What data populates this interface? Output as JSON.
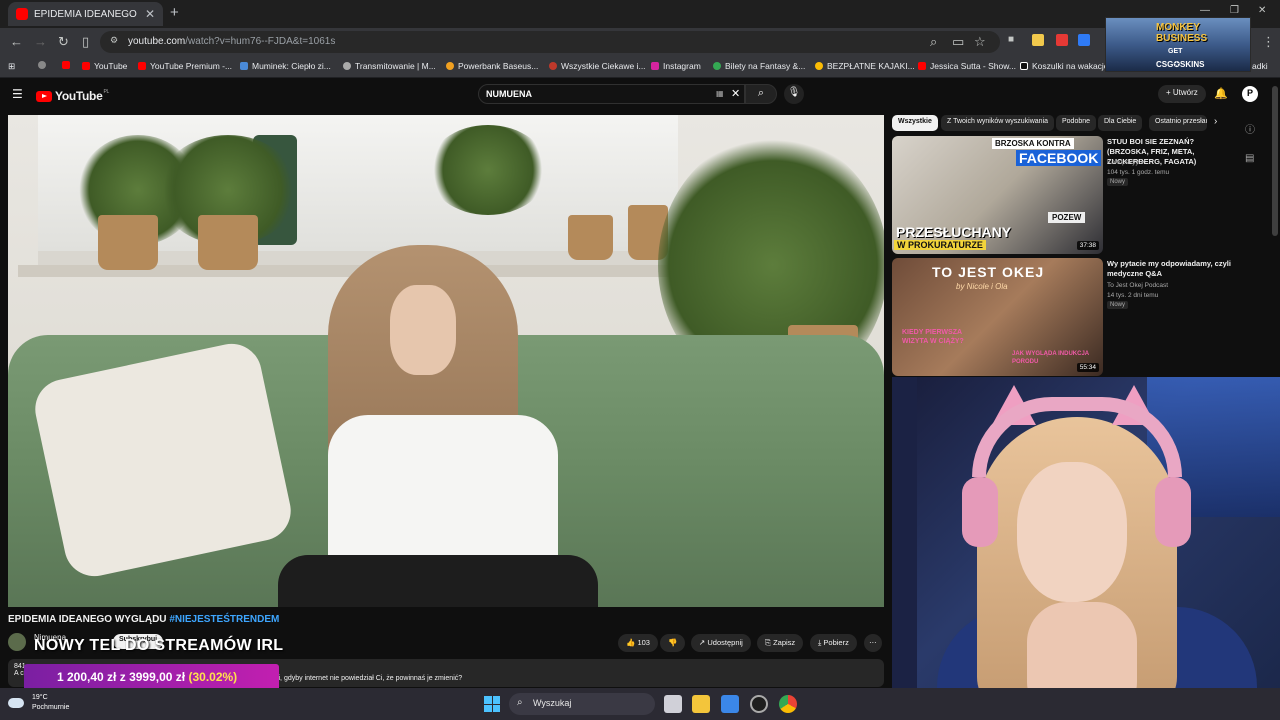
{
  "browser": {
    "tab_title": "EPIDEMIA IDEANEGO WYGLĄDU",
    "url_site": "youtube.com",
    "url_path": "/watch?v=hum76--FJDA&t=1061s",
    "bookmarks": [
      "YouTube",
      "YouTube Premium -...",
      "Muminek: Ciepło zi...",
      "Transmitowanie | M...",
      "Powerbank Baseus...",
      "Wszystkie Ciekawe i...",
      "Instagram",
      "Bilety na Fantasy &...",
      "BEZPŁATNE KAJAKI...",
      "Jessica Sutta - Show...",
      "Koszulki na wakacje"
    ],
    "bookmarks_more": "adki"
  },
  "ad": {
    "line1": "MONKEY BUSINESS",
    "line2": "GET",
    "line3": "CSG✪SKINS"
  },
  "youtube": {
    "logo_text": "YouTube",
    "logo_region": "PL",
    "search_value": "NUMUENA",
    "create_label": "Utwórz",
    "avatar_letter": "P"
  },
  "video": {
    "title_main": "EPIDEMIA IDEANEGO WYGLĄDU ",
    "title_tag": "#NIEJESTEŚTRENDEM",
    "channel": "Nimuena",
    "subscribe_label": "Subskrybuj",
    "overlay_text": "NOWY TEL DO STREAMÓW IRL",
    "likes": "103",
    "share_label": "Udostępnij",
    "save_label": "Zapisz",
    "download_label": "Pobierz",
    "desc_views": "841",
    "desc_line2": "y Ci, gdyby internet nie powiedział Ci, że powinnaś je zmienić?",
    "desc_a": "A c"
  },
  "price_overlay": {
    "current": "1 200,40 zł",
    "target": "z 3999,00 zł",
    "percent": "(30.02%)"
  },
  "chips": [
    "Wszystkie",
    "Z Twoich wyników wyszukiwania",
    "Podobne",
    "Dla Ciebie",
    "Ostatnio przesłane"
  ],
  "recommended": [
    {
      "title": "STUU BOI SIE ZEZNAŃ? (BRZOSKA, FRIZ, META, ZUCKERBERG, FAGATA)",
      "channel": "Konopskyy ✔",
      "meta": "104 tys.  1 godz. temu",
      "badge": "Nowy",
      "duration": "37:38",
      "thumb_text1": "BRZOSKA KONTRA",
      "thumb_text2": "FACEBOOK",
      "thumb_text3": "PRZESŁUCHANY",
      "thumb_text4": "W PROKURATURZE",
      "thumb_text5": "POZEW"
    },
    {
      "title": "Wy pytacie my odpowiadamy, czyli medyczne Q&A",
      "channel": "To Jest Okej Podcast",
      "meta": "14 tys.  2 dni temu",
      "badge": "Nowy",
      "duration": "55:34",
      "thumb_text1": "TO JEST OKEJ",
      "thumb_text2": "by Nicole i Ola",
      "thumb_text3": "KIEDY PIERWSZA WIZYTA W CIĄŻY?",
      "thumb_text4": "JAK WYGLĄDA INDUKCJA PORODU"
    }
  ],
  "taskbar": {
    "temp": "19°C",
    "weather": "Pochmurnie",
    "search_placeholder": "Wyszukaj"
  },
  "colors": {
    "yt_red": "#ff0000",
    "link_blue": "#3ea6ff",
    "price_gradient_start": "#7a1fa2",
    "price_gradient_end": "#c21fb0",
    "price_percent": "#ffe14d"
  }
}
